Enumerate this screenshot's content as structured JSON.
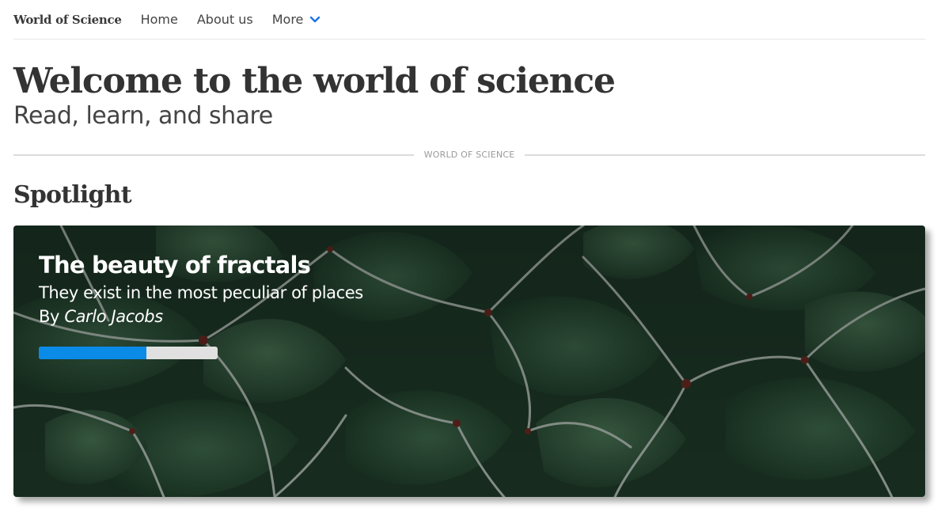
{
  "nav": {
    "brand": "World of Science",
    "links": [
      {
        "label": "Home"
      },
      {
        "label": "About us"
      }
    ],
    "more_label": "More",
    "more_icon": "chevron-down-icon",
    "accent_color": "#1a73e8"
  },
  "hero": {
    "title": "Welcome to the world of science",
    "subtitle": "Read, learn, and share"
  },
  "divider": {
    "label": "WORLD OF SCIENCE"
  },
  "spotlight": {
    "heading": "Spotlight",
    "card": {
      "title": "The beauty of fractals",
      "subtitle": "They exist in the most peculiar of places",
      "byline_prefix": "By",
      "author": "Carlo Jacobs",
      "background": "cactus-succulent-photo",
      "progress": 0.6,
      "progress_color": "#0a8be8"
    }
  }
}
